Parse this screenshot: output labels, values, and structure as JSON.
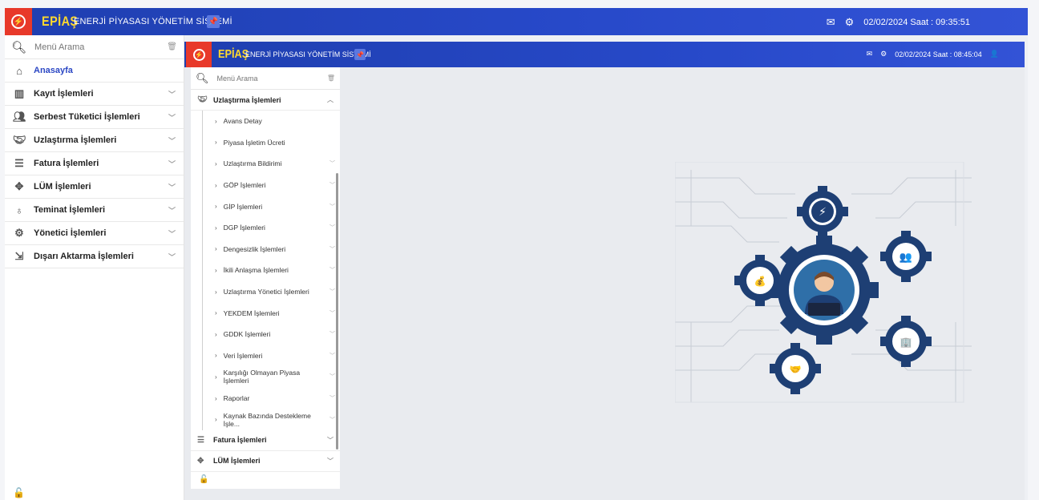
{
  "outer": {
    "brand": "EPİAŞ",
    "system_name": "ENERJİ PİYASASI YÖNETİM SİSTEMİ",
    "datetime": "02/02/2024 Saat : 09:35:51",
    "search_placeholder": "Menü Arama",
    "menu": [
      {
        "label": "Anasayfa",
        "icon": "home-icon"
      },
      {
        "label": "Kayıt İşlemleri",
        "icon": "building-icon"
      },
      {
        "label": "Serbest Tüketici İşlemleri",
        "icon": "users-icon"
      },
      {
        "label": "Uzlaştırma İşlemleri",
        "icon": "handshake-icon"
      },
      {
        "label": "Fatura İşlemleri",
        "icon": "invoice-icon"
      },
      {
        "label": "LÜM İşlemleri",
        "icon": "lum-icon"
      },
      {
        "label": "Teminat İşlemleri",
        "icon": "moneybag-icon"
      },
      {
        "label": "Yönetici İşlemleri",
        "icon": "admin-gear-icon"
      },
      {
        "label": "Dışarı Aktarma İşlemleri",
        "icon": "export-icon"
      }
    ]
  },
  "inner": {
    "brand": "EPİAŞ",
    "system_name": "ENERJİ PİYASASI YÖNETİM SİSTEMİ",
    "datetime": "02/02/2024 Saat : 08:45:04",
    "search_placeholder": "Menü Arama",
    "open_group": "Uzlaştırma İşlemleri",
    "sub_items": [
      {
        "label": "Avans Detay",
        "has_children": false
      },
      {
        "label": "Piyasa İşletim Ücreti",
        "has_children": false
      },
      {
        "label": "Uzlaştırma Bildirimi",
        "has_children": true
      },
      {
        "label": "GÖP İşlemleri",
        "has_children": true
      },
      {
        "label": "GİP İşlemleri",
        "has_children": true
      },
      {
        "label": "DGP İşlemleri",
        "has_children": true
      },
      {
        "label": "Dengesizlik İşlemleri",
        "has_children": true
      },
      {
        "label": "İkili Anlaşma İşlemleri",
        "has_children": true
      },
      {
        "label": "Uzlaştırma Yönetici İşlemleri",
        "has_children": true
      },
      {
        "label": "YEKDEM İşlemleri",
        "has_children": true
      },
      {
        "label": "GDDK İşlemleri",
        "has_children": true
      },
      {
        "label": "Veri İşlemleri",
        "has_children": true
      },
      {
        "label": "Karşılığı Olmayan Piyasa İşlemleri",
        "has_children": true
      },
      {
        "label": "Raporlar",
        "has_children": true
      },
      {
        "label": "Kaynak Bazında Destekleme İşle...",
        "has_children": true
      }
    ],
    "after_groups": [
      {
        "label": "Fatura İşlemleri"
      },
      {
        "label": "LÜM İşlemleri"
      }
    ]
  },
  "colors": {
    "topbar": "#2749c9",
    "logo_bg": "#e8392a",
    "brand_yellow": "#ffd92e",
    "active_link": "#2c48c4",
    "gear_blue": "#1e3f74"
  }
}
